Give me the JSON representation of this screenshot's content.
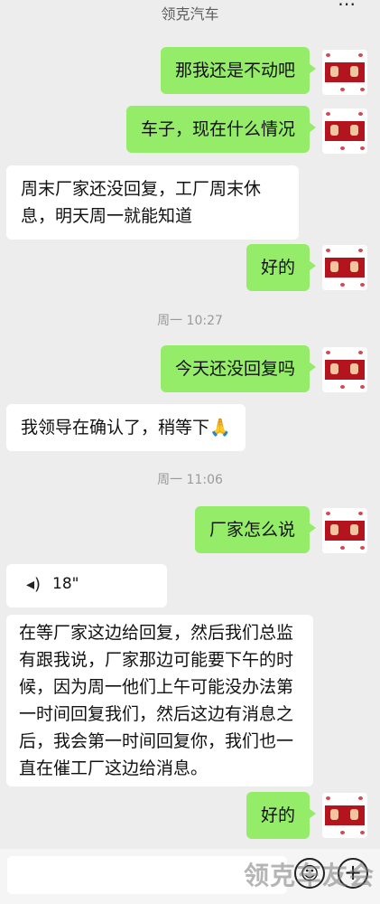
{
  "header": {
    "title": "领克汽车",
    "more_icon": "⋯",
    "clipped_text": "一 ·· ··"
  },
  "messages": [
    {
      "from": "me",
      "text": "那我还是不动吧"
    },
    {
      "from": "me",
      "text": "车子，现在什么情况"
    },
    {
      "from": "them",
      "text": "周末厂家还没回复，工厂周末休息，明天周一就能知道"
    },
    {
      "from": "me",
      "text": "好的"
    },
    {
      "type": "time",
      "text": "周一 10:27"
    },
    {
      "from": "me",
      "text": "今天还没回复吗"
    },
    {
      "from": "them",
      "text": "我领导在确认了，稍等下🙏"
    },
    {
      "type": "time",
      "text": "周一 11:06"
    },
    {
      "from": "me",
      "text": "厂家怎么说"
    },
    {
      "from": "them",
      "type": "voice",
      "icon": "voice-wave-icon",
      "duration": "18\""
    },
    {
      "from": "them",
      "text": "在等厂家这边给回复，然后我们总监有跟我说，厂家那边可能要下午的时候，因为周一他们上午可能没办法第一时间回复我们，然后这边有消息之后，我会第一时间回复你，我们也一直在催工厂这边给消息。"
    },
    {
      "from": "me",
      "text": "好的"
    }
  ],
  "input_bar": {
    "emoji_icon": "☺",
    "plus_icon": "+"
  },
  "watermark": "领克车友会",
  "colors": {
    "background": "#ededed",
    "my_bubble": "#95ec69",
    "their_bubble": "#ffffff",
    "avatar_red": "#b3141d"
  }
}
